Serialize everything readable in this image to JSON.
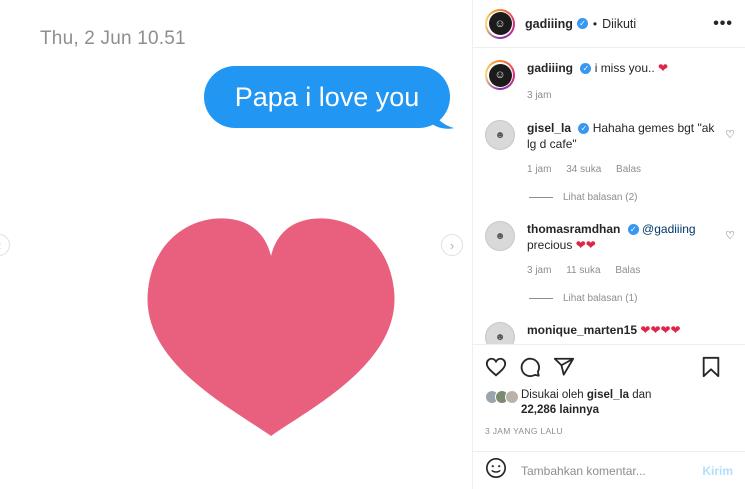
{
  "media": {
    "timestamp": "Thu, 2 Jun 10.51",
    "message": "Papa i love you"
  },
  "header": {
    "username": "gadiiing",
    "separator": "•",
    "follow_state": "Diikuti",
    "more": "•••"
  },
  "caption": {
    "username": "gadiiing",
    "text": "i miss you..",
    "emoji": "❤",
    "time": "3 jam"
  },
  "comments": [
    {
      "username": "gisel_la",
      "text": "Hahaha gemes bgt \"ak lg d cafe\"",
      "time": "1 jam",
      "likes": "34 suka",
      "reply": "Balas",
      "view_replies": "Lihat balasan (2)"
    },
    {
      "username": "thomasramdhan",
      "mention": "@gadiiing",
      "text": "precious",
      "emoji": "❤❤",
      "time": "3 jam",
      "likes": "11 suka",
      "reply": "Balas",
      "view_replies": "Lihat balasan (1)"
    },
    {
      "username": "monique_marten15",
      "emoji": "❤❤❤❤"
    }
  ],
  "likes": {
    "prefix": "Disukai oleh",
    "user": "gisel_la",
    "suffix": "dan",
    "count": "22,286 lainnya"
  },
  "post_date": "3 JAM YANG LALU",
  "comment_box": {
    "placeholder": "Tambahkan komentar...",
    "post": "Kirim"
  },
  "colors": {
    "bubble": "#2196f3",
    "heart": "#e8607e",
    "verified": "#3897f0"
  }
}
